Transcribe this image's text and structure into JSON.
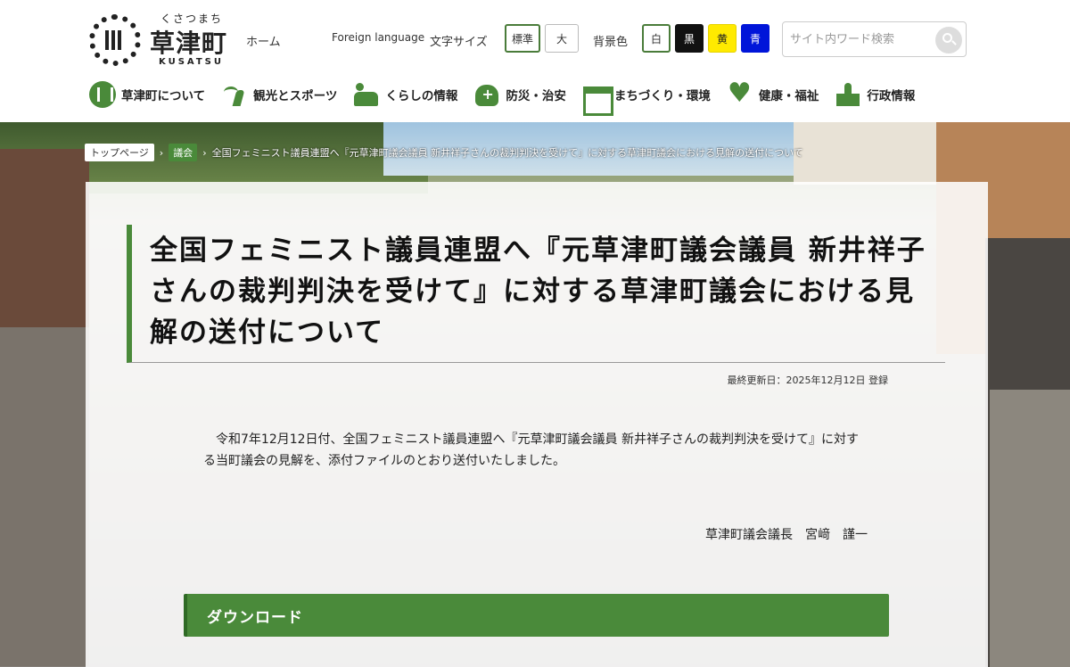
{
  "logo": {
    "ruby": "くさつまち",
    "name": "草津町",
    "roman": "KUSATSU"
  },
  "header": {
    "home": "ホーム",
    "foreign": "Foreign language",
    "fontsize_label": "文字サイズ",
    "fontsize_standard": "標準",
    "fontsize_large": "大",
    "bgcolor_label": "背景色",
    "bg_white": "白",
    "bg_black": "黒",
    "bg_yellow": "黄",
    "bg_blue": "青",
    "search_placeholder": "サイト内ワード検索"
  },
  "gnav": [
    {
      "label": "草津町について",
      "icon": "town-emblem-icon"
    },
    {
      "label": "観光とスポーツ",
      "icon": "runner-icon"
    },
    {
      "label": "くらしの情報",
      "icon": "person-desk-icon"
    },
    {
      "label": "防災・治安",
      "icon": "shield-icon"
    },
    {
      "label": "まちづくり・環境",
      "icon": "town-building-icon"
    },
    {
      "label": "健康・福祉",
      "icon": "heart-hands-icon"
    },
    {
      "label": "行政情報",
      "icon": "city-hall-icon"
    }
  ],
  "breadcrumb": {
    "home": "トップページ",
    "parent": "議会",
    "current": "全国フェミニスト議員連盟へ『元草津町議会議員 新井祥子さんの裁判判決を受けて』に対する草津町議会における見解の送付について"
  },
  "page": {
    "title": "全国フェミニスト議員連盟へ『元草津町議会議員 新井祥子さんの裁判判決を受けて』に対する草津町議会における見解の送付について",
    "updated": "最終更新日：2025年12月12日 登録",
    "body": "令和7年12月12日付、全国フェミニスト議員連盟へ『元草津町議会議員 新井祥子さんの裁判判決を受けて』に対する当町議会の見解を、添付ファイルのとおり送付いたしました。",
    "signature": "草津町議会議長　宮﨑　謹一",
    "download_heading": "ダウンロード"
  },
  "colors": {
    "accent": "#4a8a3a",
    "bg_black": "#111111",
    "bg_yellow": "#ffea00",
    "bg_blue": "#0015d9"
  }
}
